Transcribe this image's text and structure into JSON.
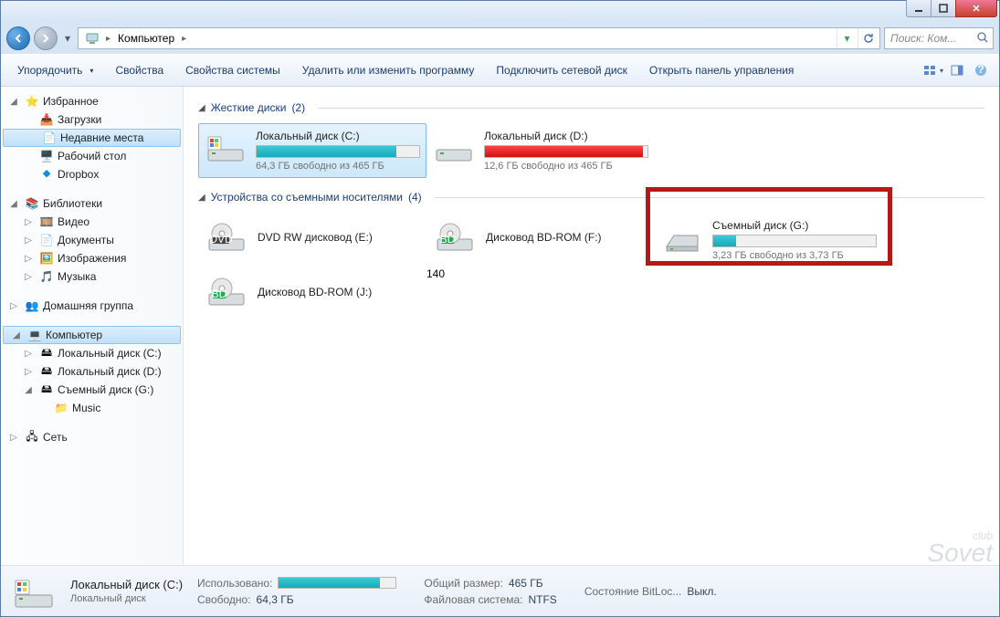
{
  "window": {
    "title": ""
  },
  "addressbar": {
    "crumb1": "Компьютер"
  },
  "search": {
    "placeholder": "Поиск: Ком..."
  },
  "toolbar": {
    "organize": "Упорядочить",
    "properties": "Свойства",
    "system_props": "Свойства системы",
    "uninstall": "Удалить или изменить программу",
    "map_drive": "Подключить сетевой диск",
    "control_panel": "Открыть панель управления"
  },
  "sidebar": {
    "favorites": "Избранное",
    "downloads": "Загрузки",
    "recent": "Недавние места",
    "desktop": "Рабочий стол",
    "dropbox": "Dropbox",
    "libraries": "Библиотеки",
    "videos": "Видео",
    "documents": "Документы",
    "pictures": "Изображения",
    "music": "Музыка",
    "homegroup": "Домашняя группа",
    "computer": "Компьютер",
    "disk_c": "Локальный диск (C:)",
    "disk_d": "Локальный диск (D:)",
    "disk_g": "Съемный диск (G:)",
    "music_folder": "Music",
    "network": "Сеть"
  },
  "content": {
    "group_hdd": {
      "label": "Жесткие диски",
      "count": "(2)"
    },
    "group_removable": {
      "label": "Устройства со съемными носителями",
      "count": "(4)"
    },
    "drive_c": {
      "name": "Локальный диск (C:)",
      "free": "64,3 ГБ свободно из 465 ГБ",
      "used_pct": 86
    },
    "drive_d": {
      "name": "Локальный диск (D:)",
      "free": "12,6 ГБ свободно из 465 ГБ",
      "used_pct": 97
    },
    "dvd_e": {
      "name": "DVD RW дисковод (E:)"
    },
    "bd_f": {
      "name": "Дисковод BD-ROM (F:)"
    },
    "drive_g": {
      "name": "Съемный диск (G:)",
      "free": "3,23 ГБ свободно из 3,73 ГБ",
      "used_pct": 14
    },
    "bd_j": {
      "name": "Дисковод BD-ROM (J:)"
    }
  },
  "details": {
    "title": "Локальный диск (C:)",
    "subtitle": "Локальный диск",
    "used_label": "Использовано:",
    "free_label": "Свободно:",
    "free_val": "64,3 ГБ",
    "total_label": "Общий размер:",
    "total_val": "465 ГБ",
    "fs_label": "Файловая система:",
    "fs_val": "NTFS",
    "bitlocker_label": "Состояние BitLoc...",
    "bitlocker_val": "Выкл.",
    "used_pct": 86
  },
  "watermark": {
    "line1": "club",
    "line2": "Sovet"
  }
}
